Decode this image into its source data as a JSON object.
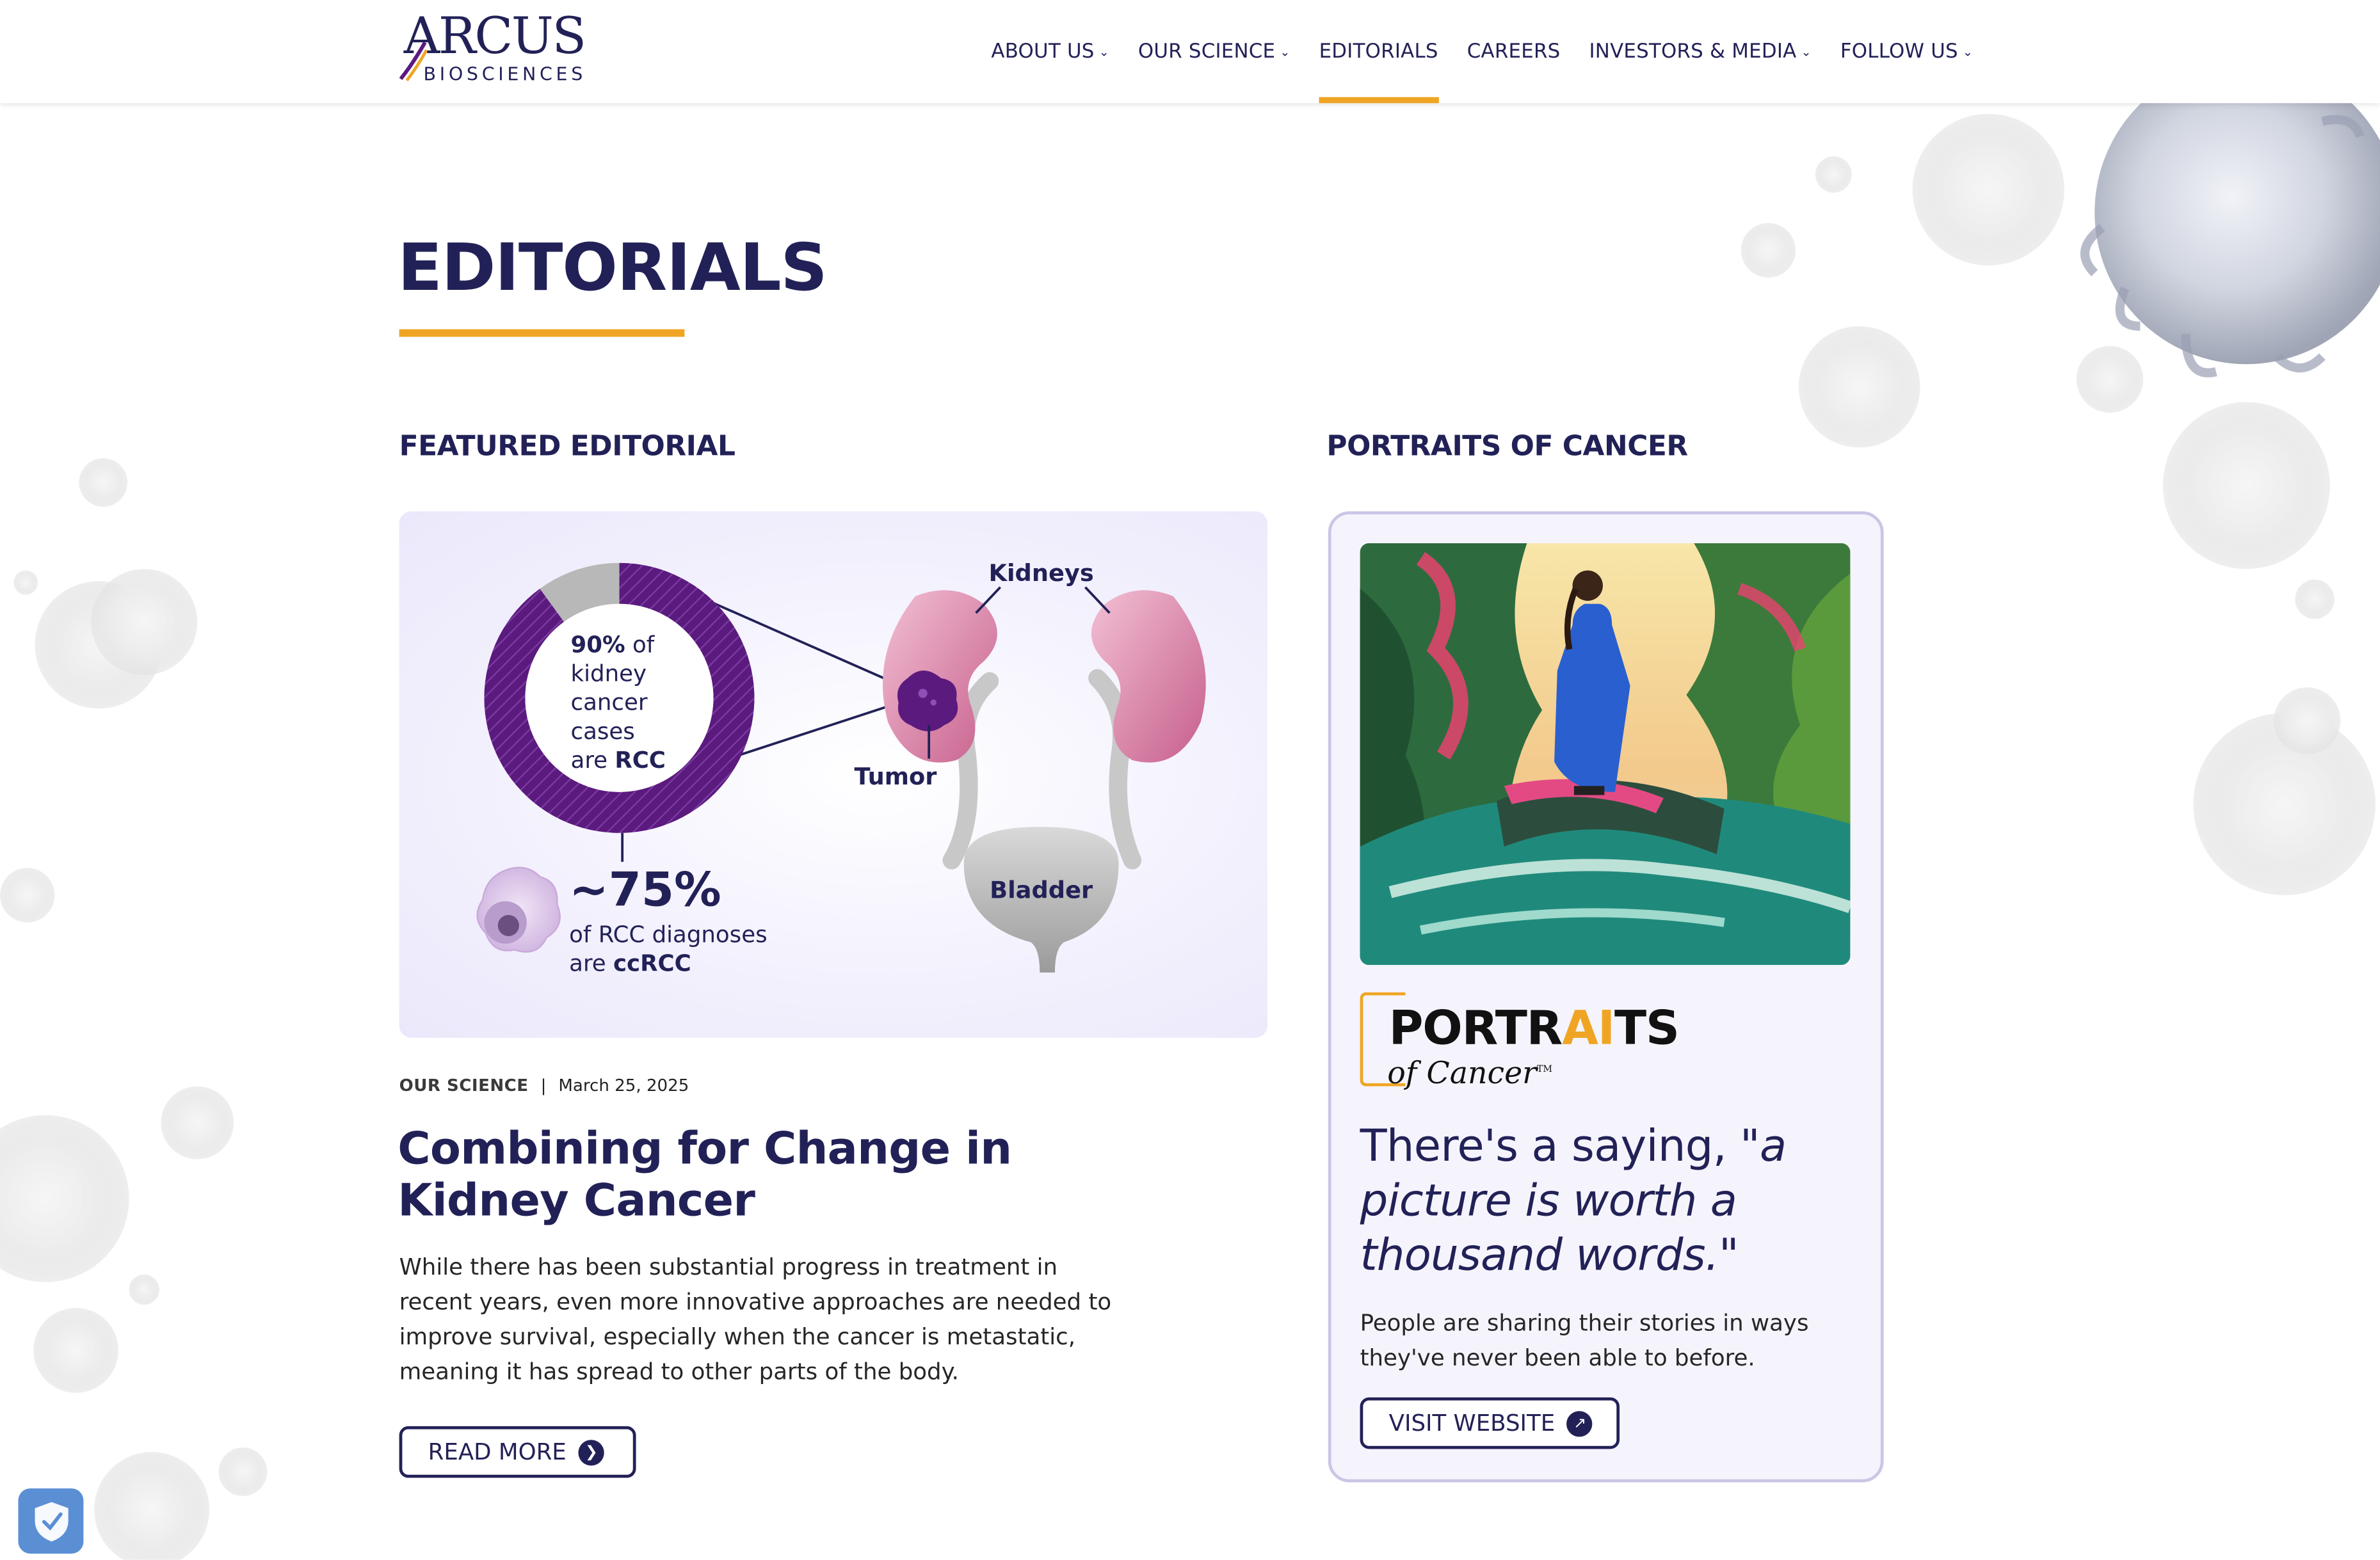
{
  "brand": {
    "name_word": "ARCUS",
    "name_sub": "BIOSCIENCES"
  },
  "nav": {
    "items": [
      {
        "label": "ABOUT US",
        "has_dropdown": true,
        "active": false
      },
      {
        "label": "OUR SCIENCE",
        "has_dropdown": true,
        "active": false
      },
      {
        "label": "EDITORIALS",
        "has_dropdown": false,
        "active": true
      },
      {
        "label": "CAREERS",
        "has_dropdown": false,
        "active": false
      },
      {
        "label": "INVESTORS & MEDIA",
        "has_dropdown": true,
        "active": false
      },
      {
        "label": "FOLLOW US",
        "has_dropdown": true,
        "active": false
      }
    ]
  },
  "page": {
    "title": "EDITORIALS"
  },
  "featured": {
    "heading": "FEATURED EDITORIAL",
    "infographic": {
      "donut_bold": "90%",
      "donut_text_1": " of",
      "donut_text_2": "kidney",
      "donut_text_3": "cancer",
      "donut_text_4": "cases",
      "donut_text_5": "are ",
      "donut_text_bold": "RCC",
      "big_stat": "~75%",
      "stat_line_1": "of RCC diagnoses",
      "stat_line_2": "are ",
      "stat_line_2_bold": "ccRCC",
      "label_kidneys": "Kidneys",
      "label_tumor": "Tumor",
      "label_bladder": "Bladder",
      "donut_share": 0.9
    },
    "category": "OUR SCIENCE",
    "separator": "|",
    "date": "March 25, 2025",
    "title": "Combining for Change in Kidney Cancer",
    "body": "While there has been substantial progress in treatment in recent years, even more innovative approaches are needed to improve survival, especially when the cancer is metastatic, meaning it has spread to other parts of the body.",
    "button_label": "READ MORE"
  },
  "portraits": {
    "heading": "PORTRAITS OF CANCER",
    "logo_part_1": "PORTR",
    "logo_part_ai": "AI",
    "logo_part_2": "TS",
    "logo_sub": "of Cancer",
    "logo_tm": "TM",
    "quote_plain": "There's a saying, ",
    "quote_italic": "\"a picture is worth a thousand words.\"",
    "body": "People are sharing their stories in ways they've never been able to before.",
    "button_label": "VISIT WEBSITE"
  },
  "colors": {
    "navy": "#222157",
    "accent": "#efa523",
    "purple": "#5b1a7e",
    "card_border": "#c9c6e6"
  }
}
